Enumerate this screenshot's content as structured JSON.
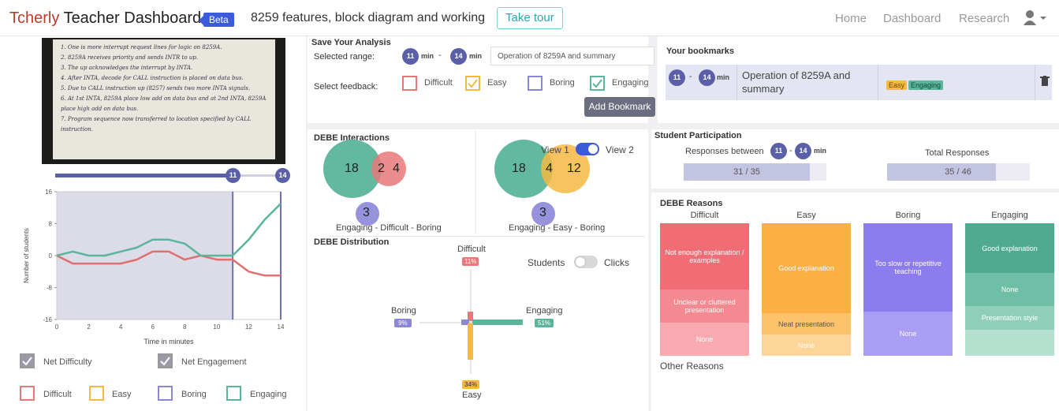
{
  "header": {
    "brand": "Tcherly",
    "title": "Teacher Dashboard",
    "badge": "Beta",
    "course": "8259 features, block diagram and working",
    "tour": "Take tour",
    "nav": [
      "Home",
      "Dashboard",
      "Research"
    ]
  },
  "video": {
    "lines": [
      "1. One is more interrupt request lines for logic on 8259A.",
      "2. 8259A receives priority and sends INTR to up.",
      "3. The up acknowledges the interrupt by INTA.",
      "4. After INTA, decode for CALL instruction is placed on data bus.",
      "5. Due to CALL instruction up (8257) sends two more INTA signals.",
      "6. At 1st INTA, 8259A place low add on data bus and at 2nd INTA, 8259A place high add on data bus.",
      "7. Program sequence now transferred to location specified by CALL instruction."
    ],
    "slider_start": "11",
    "slider_end": "14"
  },
  "chart_data": {
    "type": "line",
    "ylabel": "Number of students",
    "xlabel": "Time in minutes",
    "ylim": [
      -16,
      16
    ],
    "xlim": [
      0,
      14
    ],
    "yticks": [
      "16",
      "8",
      "0",
      "-8",
      "-16"
    ],
    "xticks": [
      "0",
      "2",
      "4",
      "6",
      "8",
      "10",
      "12",
      "14"
    ],
    "selected_range": [
      11,
      14
    ],
    "series": [
      {
        "name": "Net Difficulty",
        "color": "#e0706f",
        "x": [
          0,
          1,
          2,
          3,
          4,
          5,
          6,
          7,
          8,
          9,
          10,
          11,
          12,
          13,
          14
        ],
        "y": [
          0,
          -2,
          -2,
          -2,
          -2,
          -1,
          1,
          1,
          -1,
          0,
          -1,
          -1,
          -4,
          -5,
          -5
        ]
      },
      {
        "name": "Net Engagement",
        "color": "#5ab59a",
        "x": [
          0,
          1,
          2,
          3,
          4,
          5,
          6,
          7,
          8,
          9,
          10,
          11,
          12,
          13,
          14
        ],
        "y": [
          0,
          1,
          0,
          0,
          1,
          2,
          4,
          4,
          3,
          0,
          0,
          0,
          4,
          9,
          13
        ]
      }
    ]
  },
  "legend": {
    "net_difficulty": "Net Difficulty",
    "net_engagement": "Net Engagement",
    "difficult": "Difficult",
    "easy": "Easy",
    "boring": "Boring",
    "engaging": "Engaging"
  },
  "save": {
    "title": "Save Your Analysis",
    "selected_range": "Selected range:",
    "from": "11",
    "to": "14",
    "min": "min",
    "note": "Operation of 8259A and summary",
    "select_feedback": "Select feedback:",
    "options": [
      "Difficult",
      "Easy",
      "Boring",
      "Engaging"
    ],
    "add_button": "Add Bookmark"
  },
  "bookmarks": {
    "title": "Your bookmarks",
    "from": "11",
    "to": "14",
    "min": "min",
    "text": "Operation of 8259A and summary",
    "tags": [
      "Easy",
      "Engaging"
    ]
  },
  "interactions": {
    "title": "DEBE Interactions",
    "v1": {
      "left": "18",
      "mid": "2",
      "right": "4",
      "bottom": "3",
      "caption": "Engaging - Difficult - Boring"
    },
    "v2": {
      "left": "18",
      "mid": "4",
      "right": "12",
      "bottom": "3",
      "caption": "Engaging - Easy - Boring"
    },
    "view1": "View 1",
    "view2": "View 2"
  },
  "distribution": {
    "title": "DEBE Distribution",
    "students": "Students",
    "clicks": "Clicks",
    "difficult": "Difficult",
    "difficult_pct": "11%",
    "boring": "Boring",
    "boring_pct": "9%",
    "engaging": "Engaging",
    "engaging_pct": "51%",
    "easy": "Easy",
    "easy_pct": "34%"
  },
  "participation": {
    "title": "Student Participation",
    "responses_between": "Responses between",
    "from": "11",
    "to": "14",
    "min": "min",
    "total": "Total Responses",
    "range_value": "31 / 35",
    "range_fraction": 0.886,
    "total_value": "35 / 46",
    "total_fraction": 0.761
  },
  "reasons": {
    "title": "DEBE Reasons",
    "difficult": {
      "label": "Difficult",
      "items": [
        "Not enough explanation / examples",
        "Unclear or cluttered presentation",
        "None"
      ]
    },
    "easy": {
      "label": "Easy",
      "items": [
        "Good explanation",
        "Neat presentation",
        "None"
      ]
    },
    "boring": {
      "label": "Boring",
      "items": [
        "Too slow or repetitive teaching",
        "None"
      ]
    },
    "engaging": {
      "label": "Engaging",
      "items": [
        "Good explanation",
        "None",
        "Presentation style"
      ]
    },
    "other": "Other Reasons"
  }
}
